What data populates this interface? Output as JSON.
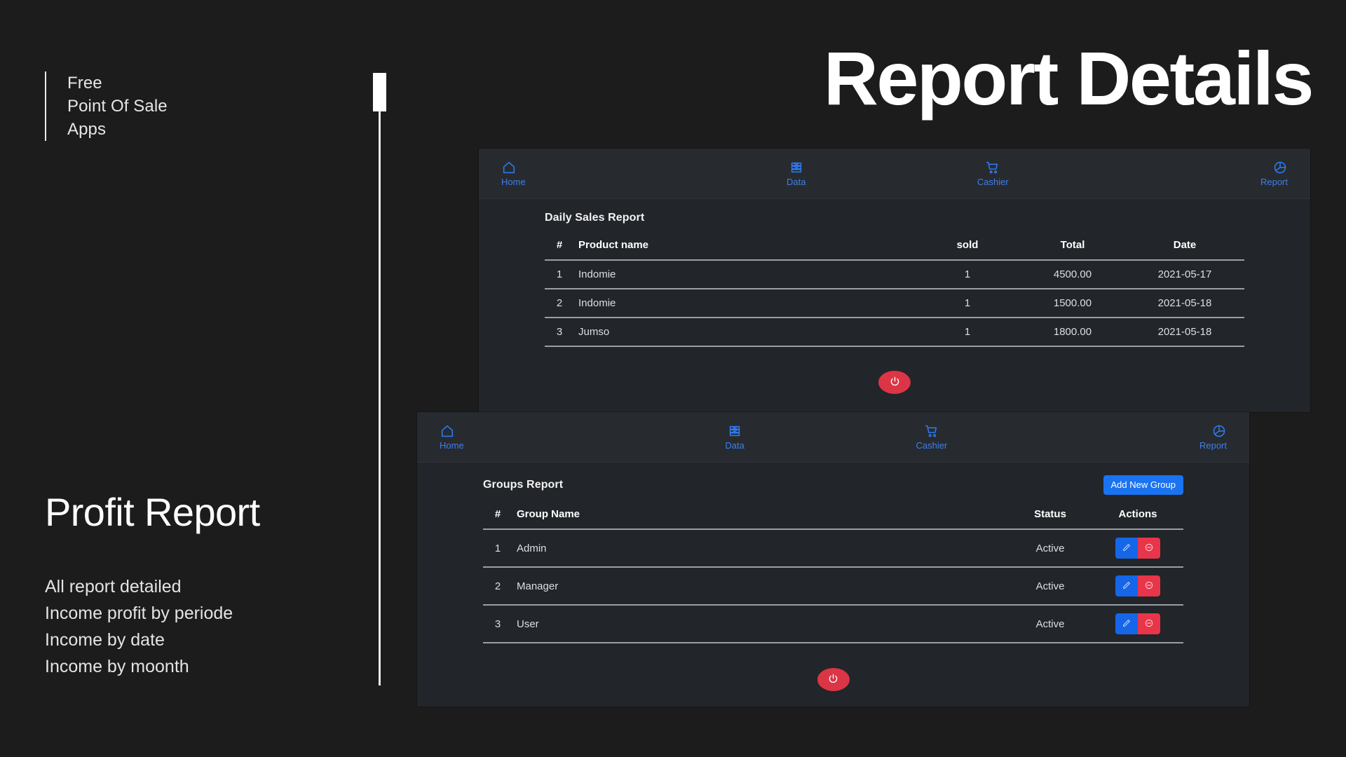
{
  "slide": {
    "background": "#1c1c1c",
    "title": "Report Details",
    "brand_lines": [
      "Free",
      "Point Of Sale",
      "Apps"
    ],
    "section_heading": "Profit Report",
    "bullets": [
      "All report detailed",
      "Income profit by periode",
      "Income by date",
      "Income by moonth"
    ]
  },
  "accents": {
    "primary_blue": "#1a73f0",
    "nav_blue": "#2f7df6",
    "danger_red": "#dc3545",
    "edit_blue": "#1566e8",
    "delete_red": "#e8354a",
    "panel_bg": "#222529",
    "navbar_bg": "#272b30"
  },
  "nav": {
    "items": [
      {
        "label": "Home",
        "icon": "home-icon"
      },
      {
        "label": "Data",
        "icon": "database-icon"
      },
      {
        "label": "Cashier",
        "icon": "shopping-cart-icon"
      },
      {
        "label": "Report",
        "icon": "pie-chart-icon"
      }
    ]
  },
  "panel_one": {
    "card_title": "Daily Sales Report",
    "columns": [
      "#",
      "Product name",
      "sold",
      "Total",
      "Date"
    ],
    "rows": [
      {
        "idx": "1",
        "product": "Indomie",
        "sold": "1",
        "total": "4500.00",
        "date": "2021-05-17"
      },
      {
        "idx": "2",
        "product": "Indomie",
        "sold": "1",
        "total": "1500.00",
        "date": "2021-05-18"
      },
      {
        "idx": "3",
        "product": "Jumso",
        "sold": "1",
        "total": "1800.00",
        "date": "2021-05-18"
      }
    ],
    "power_button": "power-icon"
  },
  "panel_two": {
    "card_title": "Groups Report",
    "add_button": "Add New Group",
    "columns": [
      "#",
      "Group Name",
      "Status",
      "Actions"
    ],
    "rows": [
      {
        "idx": "1",
        "group": "Admin",
        "status": "Active"
      },
      {
        "idx": "2",
        "group": "Manager",
        "status": "Active"
      },
      {
        "idx": "3",
        "group": "User",
        "status": "Active"
      }
    ],
    "actions": {
      "edit": "edit-pencil-icon",
      "delete": "remove-circle-icon"
    },
    "power_button": "power-icon"
  }
}
